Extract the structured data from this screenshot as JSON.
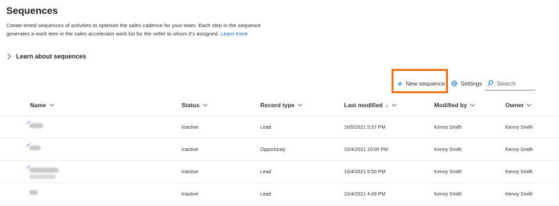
{
  "page": {
    "title": "Sequences",
    "description": "Create timed sequences of activities to optimize the sales cadence for your team. Each step in the sequence generates a work item in the sales accelerator work list for the seller to whom it's assigned.",
    "learn_more": "Learn more",
    "learn_about": "Learn about sequences"
  },
  "toolbar": {
    "new_sequence": "New sequence",
    "settings": "Settings",
    "search_placeholder": "Search"
  },
  "table": {
    "columns": [
      "Name",
      "Status",
      "Record type",
      "Last modified",
      "Modified by",
      "Owner"
    ],
    "sort_arrow": "↓",
    "rows": [
      {
        "status": "Inactive",
        "record_type": "Lead",
        "last_modified": "10/5/2021 5:37 PM",
        "modified_by": "Kenny Smith",
        "owner": "Kenny Smith"
      },
      {
        "status": "Inactive",
        "record_type": "Opportunity",
        "last_modified": "10/4/2021 10:05 PM",
        "modified_by": "Kenny Smith",
        "owner": "Kenny Smith"
      },
      {
        "status": "Inactive",
        "record_type": "Lead",
        "last_modified": "10/4/2021 6:50 PM",
        "modified_by": "Kenny Smith",
        "owner": "Kenny Smith"
      },
      {
        "status": "Inactive",
        "record_type": "Lead",
        "last_modified": "10/4/2021 4:49 PM",
        "modified_by": "Kenny Smith",
        "owner": "Kenny Smith"
      }
    ]
  },
  "colors": {
    "accent": "#0f6cbd",
    "highlight": "#e87722"
  }
}
